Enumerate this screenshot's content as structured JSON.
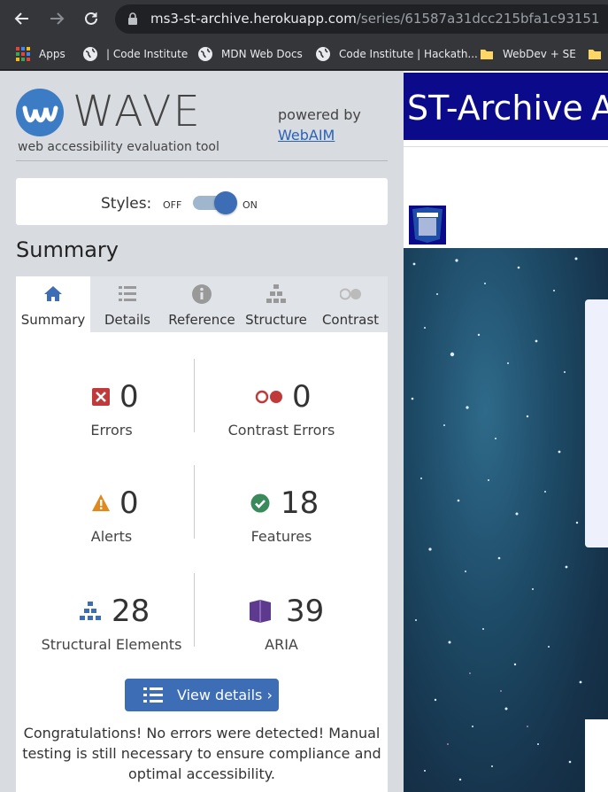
{
  "browser": {
    "url_host": "ms3-st-archive.herokuapp.com",
    "url_path": "/series/61587a31dcc215bfa1c93151",
    "bookmarks": [
      {
        "label": "Apps",
        "icon": "apps-grid-icon"
      },
      {
        "label": "| Code Institute",
        "icon": "globe-icon"
      },
      {
        "label": "MDN Web Docs",
        "icon": "globe-icon"
      },
      {
        "label": "Code Institute | Hackath...",
        "icon": "globe-icon"
      },
      {
        "label": "WebDev + SE",
        "icon": "folder-icon"
      }
    ]
  },
  "wave": {
    "brand": "WAVE",
    "tagline": "web accessibility evaluation tool",
    "powered_by": "powered by",
    "webaim": "WebAIM",
    "styles_label": "Styles:",
    "styles_off": "OFF",
    "styles_on": "ON",
    "summary_heading": "Summary",
    "tabs": [
      {
        "label": "Summary",
        "icon": "home-icon",
        "active": true
      },
      {
        "label": "Details",
        "icon": "list-icon",
        "active": false
      },
      {
        "label": "Reference",
        "icon": "info-icon",
        "active": false
      },
      {
        "label": "Structure",
        "icon": "structure-icon",
        "active": false
      },
      {
        "label": "Contrast",
        "icon": "contrast-icon",
        "active": false
      }
    ],
    "stats": [
      {
        "value": "0",
        "label": "Errors",
        "icon": "error-icon"
      },
      {
        "value": "0",
        "label": "Contrast Errors",
        "icon": "contrast-error-icon"
      },
      {
        "value": "0",
        "label": "Alerts",
        "icon": "alert-icon"
      },
      {
        "value": "18",
        "label": "Features",
        "icon": "feature-check-icon"
      },
      {
        "value": "28",
        "label": "Structural Elements",
        "icon": "structural-icon"
      },
      {
        "value": "39",
        "label": "ARIA",
        "icon": "aria-icon"
      }
    ],
    "view_details": "View details ›",
    "congrats": "Congratulations! No errors were detected! Manual testing is still necessary to ensure compliance and optimal accessibility."
  },
  "page": {
    "site_title": "ST-Archive",
    "nav_cut": "A"
  },
  "colors": {
    "accent": "#3c6db5",
    "error": "#c0393b",
    "alert": "#e08a1e",
    "feature": "#3a8a5c",
    "aria": "#5d3a8e",
    "navbar": "#0a0a8a"
  }
}
